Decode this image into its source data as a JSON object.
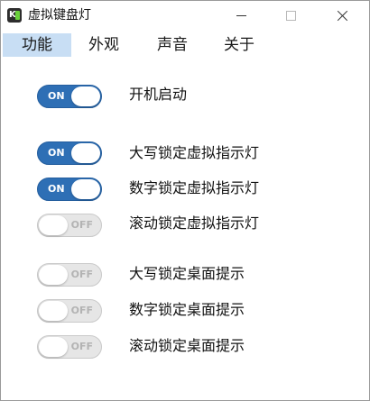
{
  "window": {
    "title": "虚拟键盘灯",
    "icon": "keyboard-led-app-icon",
    "controls": [
      "minimize",
      "maximize",
      "close"
    ]
  },
  "tabs": [
    {
      "label": "功能",
      "active": true
    },
    {
      "label": "外观",
      "active": false
    },
    {
      "label": "声音",
      "active": false
    },
    {
      "label": "关于",
      "active": false
    }
  ],
  "toggle_text": {
    "on": "ON",
    "off": "OFF"
  },
  "settings": [
    {
      "label": "开机启动",
      "state": "ON"
    },
    {
      "label": "大写锁定虚拟指示灯",
      "state": "ON"
    },
    {
      "label": "数字锁定虚拟指示灯",
      "state": "ON"
    },
    {
      "label": "滚动锁定虚拟指示灯",
      "state": "OFF"
    },
    {
      "label": "大写锁定桌面提示",
      "state": "OFF"
    },
    {
      "label": "数字锁定桌面提示",
      "state": "OFF"
    },
    {
      "label": "滚动锁定桌面提示",
      "state": "OFF"
    }
  ],
  "colors": {
    "toggle_on": "#2e6fb5",
    "toggle_off": "#e6e6e6",
    "active_tab": "#c8def4",
    "led_green": "#6ad13b"
  }
}
